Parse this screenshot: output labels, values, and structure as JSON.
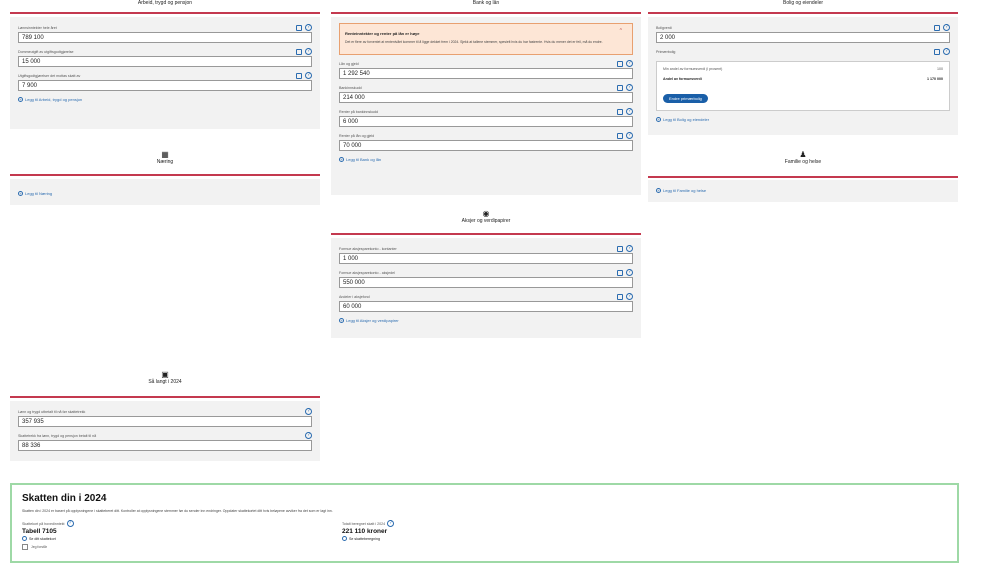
{
  "arbeid": {
    "title": "Arbeid, trygd og pensjon",
    "fields": [
      {
        "label": "Lønnsinntekter hele året",
        "value": "789 100"
      },
      {
        "label": "Dommeutgift av utgiftsgodtgjørelse",
        "value": "15 000"
      },
      {
        "label": "Utgiftsgodtgjørelser det mottas skatt av",
        "value": "7 900"
      }
    ],
    "add": "Legg til Arbeid, trygd og pensjon"
  },
  "naering": {
    "title": "Næring",
    "add": "Legg til Næring"
  },
  "bank": {
    "title": "Bank og lån",
    "warn_title": "Renteinntekter og renter på lån er høye",
    "warn_body": "Det er flere av forventet at rentenivået kommer til å ligge dekket frem i 2024. Sjekk at tallene stemmer, spesielt hvis du har fastrente. Hvis du mener det er feil, må du endre.",
    "fields": [
      {
        "label": "Lån og gjeld",
        "value": "1 292 540"
      },
      {
        "label": "Bankinnskudd",
        "value": "214 000"
      },
      {
        "label": "Renter på bankinnskudd",
        "value": "6 000"
      },
      {
        "label": "Renter på lån og gjeld",
        "value": "70 000"
      }
    ],
    "add": "Legg til Bank og lån"
  },
  "bolig": {
    "title": "Bolig og eiendeler",
    "fields": [
      {
        "label": "Boligverdi",
        "value": "2 000"
      }
    ],
    "primary_label": "Primærbolig",
    "inner_row1_label": "Min andel av formuesverdi (i prosent)",
    "inner_row1_value": "100",
    "inner_row2_label": "Andel av formuesverdi",
    "inner_row2_value": "1 170 000",
    "button": "Endre primærbolig",
    "add": "Legg til Bolig og eiendeler"
  },
  "familie": {
    "title": "Familie og helse",
    "add": "Legg til Familie og helse"
  },
  "aksjer": {
    "title": "Aksjer og verdipapirer",
    "fields": [
      {
        "label": "Formue aksjesparekonto - kontanter",
        "value": "1 000"
      },
      {
        "label": "Formue aksjesparekonto - aksjedel",
        "value": "550 000"
      },
      {
        "label": "Andeler i aksjefond",
        "value": "60 000"
      }
    ],
    "add": "Legg til Aksjer og verdipapirer"
  },
  "saa_langt": {
    "title": "Så langt i 2024",
    "fields": [
      {
        "label": "Lønn og trygd utbetalt til nå før skattetrekk",
        "value": "357 935"
      },
      {
        "label": "Skattetrekk fra lønn, trygd og pensjon betalt til nå",
        "value": "88 336"
      }
    ]
  },
  "skatt": {
    "title": "Skatten din i 2024",
    "desc": "Skatten din i 2024 er basert på opplysningene i skatteberet ditt. Kontroller at opplysningene stemmer før du sender inn endringer. Oppdater skattekortet ditt hvis beløpene avviker fra det som er lagt inn.",
    "left_label": "Skattekort på hovedinntekt",
    "left_value": "Tabell 7105",
    "left_sub": "Se ditt skattekort",
    "right_label": "Totalt beregnet skatt i 2024",
    "right_value": "221 110 kroner",
    "right_sub": "Se skatteberegning",
    "checkbox": "Jeg forstår"
  }
}
